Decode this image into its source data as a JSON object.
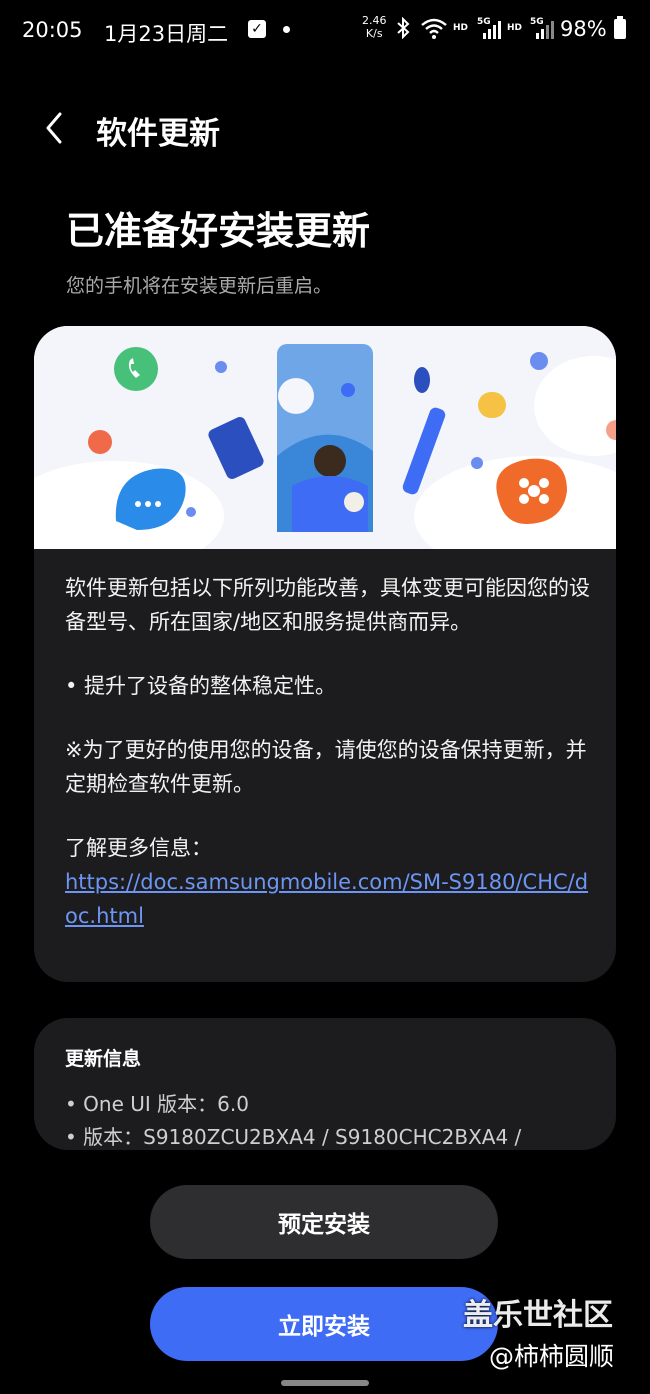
{
  "status_bar": {
    "time": "20:05",
    "date": "1月23日周二",
    "speed_value": "2.46",
    "speed_unit": "K/s",
    "hd_label": "HD",
    "net_label": "5G",
    "battery": "98%"
  },
  "header": {
    "title": "软件更新"
  },
  "main": {
    "headline": "已准备好安装更新",
    "subtitle": "您的手机将在安装更新后重启。"
  },
  "notes": {
    "intro": "软件更新包括以下所列功能改善，具体变更可能因您的设备型号、所在国家/地区和服务提供商而异。",
    "bullet": "• 提升了设备的整体稳定性。",
    "tip": "※为了更好的使用您的设备，请使您的设备保持更新，并定期检查软件更新。",
    "more_label": "了解更多信息：",
    "link": "https://doc.samsungmobile.com/SM-S9180/CHC/doc.html"
  },
  "update_info": {
    "title": "更新信息",
    "one_ui": "• One UI 版本：6.0",
    "version": "• 版本：S9180ZCU2BXA4 / S9180CHC2BXA4 /"
  },
  "buttons": {
    "schedule": "预定安装",
    "install_now": "立即安装"
  },
  "watermark": {
    "line1": "盖乐世社区",
    "line2": "@柿柿圆顺"
  },
  "colors": {
    "accent": "#3f6cf5",
    "link": "#6d95f3",
    "card": "#1c1c1e"
  }
}
